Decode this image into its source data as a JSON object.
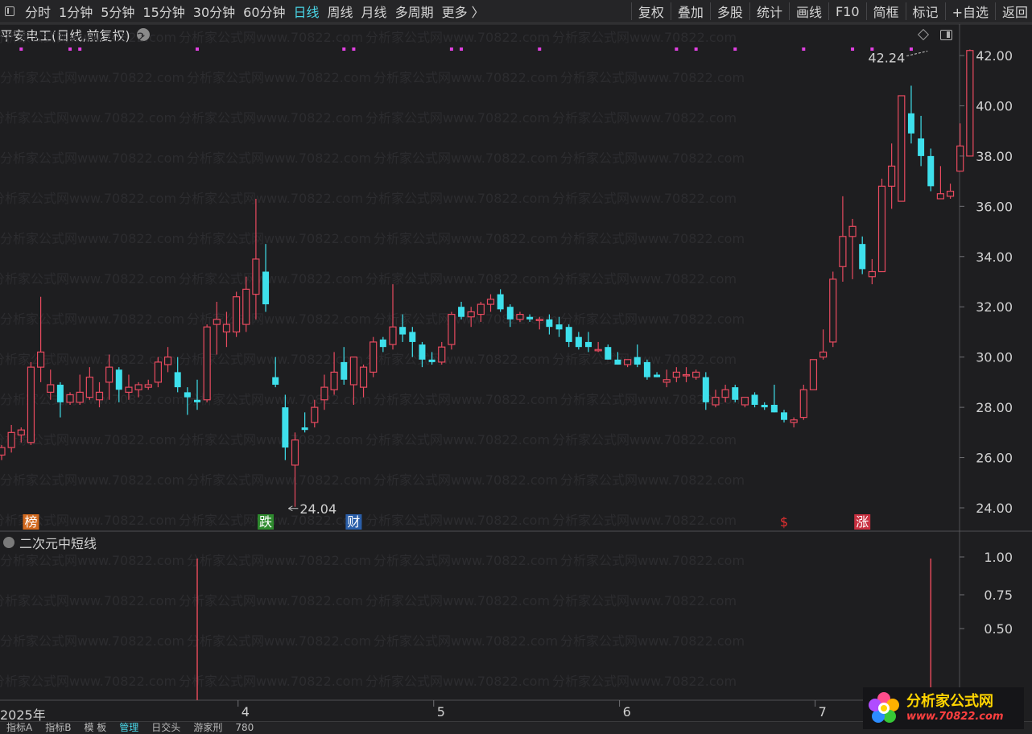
{
  "toolbar": {
    "left_items": [
      {
        "label": "分时",
        "active": false
      },
      {
        "label": "1分钟",
        "active": false
      },
      {
        "label": "5分钟",
        "active": false
      },
      {
        "label": "15分钟",
        "active": false
      },
      {
        "label": "30分钟",
        "active": false
      },
      {
        "label": "60分钟",
        "active": false
      },
      {
        "label": "日线",
        "active": true
      },
      {
        "label": "周线",
        "active": false
      },
      {
        "label": "月线",
        "active": false
      },
      {
        "label": "多周期",
        "active": false
      },
      {
        "label": "更多 〉",
        "active": false
      }
    ],
    "right_items": [
      "复权",
      "叠加",
      "多股",
      "统计",
      "画线",
      "F10",
      "简框",
      "标记",
      "+自选",
      "返回"
    ]
  },
  "chart_title": "平安电工(日线,前复权)",
  "indicator_title": "二次元中短线",
  "bottom_tabs": [
    {
      "label": "指标A",
      "active": false
    },
    {
      "label": "指标B",
      "active": false
    },
    {
      "label": "模 板",
      "active": false
    },
    {
      "label": "管理",
      "active": true
    },
    {
      "label": "日交头",
      "active": false
    },
    {
      "label": "游家刑",
      "active": false
    },
    {
      "label": "780",
      "active": false
    }
  ],
  "logo": {
    "name": "分析家公式网",
    "url": "www.70822.com"
  },
  "watermark_text": "分析家公式网www.70822.com",
  "colors": {
    "up": "#e84a5f",
    "down": "#3ee0ec",
    "background": "#1e1e20",
    "marker_dot": "#e040e0"
  },
  "chart_data": [
    {
      "type": "candlestick",
      "title": "平安电工(日线,前复权)",
      "ylim": [
        23.3,
        42.9
      ],
      "y_ticks": [
        "42.00",
        "40.00",
        "38.00",
        "36.00",
        "34.00",
        "32.00",
        "30.00",
        "28.00",
        "26.00",
        "24.00"
      ],
      "y_tick_values": [
        42,
        40,
        38,
        36,
        34,
        32,
        30,
        28,
        26,
        24
      ],
      "x_labels": [
        "2025年",
        "4",
        "5",
        "6",
        "7"
      ],
      "x_label_index": [
        0,
        25,
        45,
        64,
        84
      ],
      "annotations": [
        {
          "text": "42.24",
          "index": 95,
          "price": 42.24,
          "kind": "max"
        },
        {
          "text": "24.04",
          "index": 29,
          "price": 24.04,
          "kind": "min"
        }
      ],
      "event_markers": [
        {
          "text": "榜",
          "index": 3,
          "color": "#d2691e"
        },
        {
          "text": "跌",
          "index": 27,
          "color": "#2e8b2e"
        },
        {
          "text": "财",
          "index": 36,
          "color": "#2a5ea8"
        },
        {
          "text": "$",
          "index": 80,
          "color": "#e83030"
        },
        {
          "text": "涨",
          "index": 88,
          "color": "#c83040"
        }
      ],
      "top_dots_index": [
        2,
        7,
        8,
        20,
        35,
        36,
        46,
        47,
        55,
        69,
        71,
        75,
        82,
        87,
        89,
        93
      ],
      "candles": [
        {
          "o": 26.1,
          "h": 26.5,
          "l": 25.9,
          "c": 26.4
        },
        {
          "o": 26.4,
          "h": 27.3,
          "l": 26.2,
          "c": 27.0
        },
        {
          "o": 26.9,
          "h": 27.2,
          "l": 26.6,
          "c": 27.1
        },
        {
          "o": 26.6,
          "h": 29.8,
          "l": 26.5,
          "c": 29.6
        },
        {
          "o": 29.6,
          "h": 32.4,
          "l": 29.0,
          "c": 30.2
        },
        {
          "o": 28.6,
          "h": 29.5,
          "l": 28.3,
          "c": 28.9
        },
        {
          "o": 28.9,
          "h": 29.0,
          "l": 27.6,
          "c": 28.2
        },
        {
          "o": 28.2,
          "h": 28.6,
          "l": 28.1,
          "c": 28.5
        },
        {
          "o": 28.2,
          "h": 29.3,
          "l": 28.1,
          "c": 28.6
        },
        {
          "o": 28.4,
          "h": 29.6,
          "l": 28.3,
          "c": 29.2
        },
        {
          "o": 28.3,
          "h": 29.0,
          "l": 28.0,
          "c": 28.6
        },
        {
          "o": 29.0,
          "h": 30.1,
          "l": 28.3,
          "c": 29.6
        },
        {
          "o": 29.5,
          "h": 29.6,
          "l": 28.2,
          "c": 28.7
        },
        {
          "o": 28.6,
          "h": 29.3,
          "l": 28.3,
          "c": 28.8
        },
        {
          "o": 28.7,
          "h": 29.0,
          "l": 28.4,
          "c": 28.9
        },
        {
          "o": 28.8,
          "h": 29.1,
          "l": 28.7,
          "c": 28.9
        },
        {
          "o": 29.0,
          "h": 30.0,
          "l": 28.8,
          "c": 29.8
        },
        {
          "o": 29.7,
          "h": 30.4,
          "l": 29.4,
          "c": 30.0
        },
        {
          "o": 29.4,
          "h": 30.0,
          "l": 28.6,
          "c": 28.8
        },
        {
          "o": 28.6,
          "h": 28.8,
          "l": 27.7,
          "c": 28.4
        },
        {
          "o": 28.3,
          "h": 29.1,
          "l": 27.9,
          "c": 28.2
        },
        {
          "o": 28.3,
          "h": 31.3,
          "l": 28.2,
          "c": 31.2
        },
        {
          "o": 31.3,
          "h": 32.2,
          "l": 30.1,
          "c": 31.5
        },
        {
          "o": 31.0,
          "h": 31.8,
          "l": 30.4,
          "c": 31.3
        },
        {
          "o": 31.0,
          "h": 32.6,
          "l": 30.8,
          "c": 32.4
        },
        {
          "o": 31.3,
          "h": 33.2,
          "l": 31.0,
          "c": 32.7
        },
        {
          "o": 32.5,
          "h": 36.3,
          "l": 31.5,
          "c": 33.9
        },
        {
          "o": 33.4,
          "h": 34.5,
          "l": 31.8,
          "c": 32.1
        },
        {
          "o": 29.2,
          "h": 30.0,
          "l": 28.8,
          "c": 28.9
        },
        {
          "o": 28.0,
          "h": 28.5,
          "l": 25.9,
          "c": 26.4
        },
        {
          "o": 25.7,
          "h": 27.0,
          "l": 24.04,
          "c": 26.7
        },
        {
          "o": 27.2,
          "h": 27.8,
          "l": 27.0,
          "c": 27.1
        },
        {
          "o": 27.4,
          "h": 28.3,
          "l": 27.2,
          "c": 28.0
        },
        {
          "o": 28.3,
          "h": 29.3,
          "l": 27.9,
          "c": 28.8
        },
        {
          "o": 28.7,
          "h": 30.2,
          "l": 28.5,
          "c": 29.4
        },
        {
          "o": 29.8,
          "h": 30.4,
          "l": 28.9,
          "c": 29.1
        },
        {
          "o": 28.9,
          "h": 30.0,
          "l": 28.1,
          "c": 30.0
        },
        {
          "o": 28.8,
          "h": 29.7,
          "l": 28.4,
          "c": 29.6
        },
        {
          "o": 29.4,
          "h": 30.8,
          "l": 29.2,
          "c": 30.6
        },
        {
          "o": 30.7,
          "h": 30.8,
          "l": 30.2,
          "c": 30.4
        },
        {
          "o": 30.5,
          "h": 32.9,
          "l": 30.3,
          "c": 31.2
        },
        {
          "o": 31.2,
          "h": 31.7,
          "l": 30.6,
          "c": 30.9
        },
        {
          "o": 31.0,
          "h": 31.2,
          "l": 30.0,
          "c": 30.6
        },
        {
          "o": 30.5,
          "h": 30.6,
          "l": 29.6,
          "c": 29.9
        },
        {
          "o": 29.9,
          "h": 30.2,
          "l": 29.7,
          "c": 29.8
        },
        {
          "o": 29.8,
          "h": 30.6,
          "l": 29.7,
          "c": 30.4
        },
        {
          "o": 30.5,
          "h": 31.8,
          "l": 30.3,
          "c": 31.7
        },
        {
          "o": 32.0,
          "h": 32.2,
          "l": 31.5,
          "c": 31.6
        },
        {
          "o": 31.6,
          "h": 32.0,
          "l": 31.2,
          "c": 31.8
        },
        {
          "o": 31.7,
          "h": 32.2,
          "l": 31.4,
          "c": 32.1
        },
        {
          "o": 32.1,
          "h": 32.5,
          "l": 31.8,
          "c": 32.3
        },
        {
          "o": 32.5,
          "h": 32.7,
          "l": 31.8,
          "c": 31.9
        },
        {
          "o": 32.0,
          "h": 32.1,
          "l": 31.2,
          "c": 31.5
        },
        {
          "o": 31.5,
          "h": 31.8,
          "l": 31.4,
          "c": 31.7
        },
        {
          "o": 31.6,
          "h": 31.7,
          "l": 31.4,
          "c": 31.5
        },
        {
          "o": 31.5,
          "h": 31.6,
          "l": 31.1,
          "c": 31.5
        },
        {
          "o": 31.5,
          "h": 31.7,
          "l": 30.9,
          "c": 31.2
        },
        {
          "o": 31.3,
          "h": 31.6,
          "l": 30.8,
          "c": 31.1
        },
        {
          "o": 31.2,
          "h": 31.3,
          "l": 30.4,
          "c": 30.6
        },
        {
          "o": 30.8,
          "h": 31.0,
          "l": 30.3,
          "c": 30.4
        },
        {
          "o": 30.6,
          "h": 31.0,
          "l": 30.2,
          "c": 30.4
        },
        {
          "o": 30.3,
          "h": 30.6,
          "l": 30.2,
          "c": 30.3
        },
        {
          "o": 30.4,
          "h": 30.5,
          "l": 29.9,
          "c": 29.9
        },
        {
          "o": 29.9,
          "h": 30.2,
          "l": 29.7,
          "c": 29.7
        },
        {
          "o": 29.7,
          "h": 29.9,
          "l": 29.6,
          "c": 29.9
        },
        {
          "o": 30.0,
          "h": 30.5,
          "l": 29.6,
          "c": 29.7
        },
        {
          "o": 29.8,
          "h": 29.9,
          "l": 29.1,
          "c": 29.2
        },
        {
          "o": 29.3,
          "h": 29.4,
          "l": 29.2,
          "c": 29.2
        },
        {
          "o": 29.0,
          "h": 29.5,
          "l": 28.8,
          "c": 29.1
        },
        {
          "o": 29.2,
          "h": 29.6,
          "l": 29.0,
          "c": 29.4
        },
        {
          "o": 29.3,
          "h": 29.6,
          "l": 29.0,
          "c": 29.3
        },
        {
          "o": 29.2,
          "h": 29.5,
          "l": 29.1,
          "c": 29.4
        },
        {
          "o": 29.2,
          "h": 29.4,
          "l": 27.9,
          "c": 28.2
        },
        {
          "o": 28.1,
          "h": 28.7,
          "l": 28.0,
          "c": 28.4
        },
        {
          "o": 28.4,
          "h": 28.9,
          "l": 28.2,
          "c": 28.7
        },
        {
          "o": 28.8,
          "h": 28.9,
          "l": 28.2,
          "c": 28.3
        },
        {
          "o": 28.1,
          "h": 28.4,
          "l": 28.0,
          "c": 28.4
        },
        {
          "o": 28.5,
          "h": 28.6,
          "l": 28.0,
          "c": 28.1
        },
        {
          "o": 28.1,
          "h": 28.2,
          "l": 27.9,
          "c": 28.0
        },
        {
          "o": 28.1,
          "h": 28.9,
          "l": 27.8,
          "c": 27.8
        },
        {
          "o": 27.8,
          "h": 27.9,
          "l": 27.4,
          "c": 27.5
        },
        {
          "o": 27.4,
          "h": 27.6,
          "l": 27.2,
          "c": 27.5
        },
        {
          "o": 27.6,
          "h": 28.9,
          "l": 27.5,
          "c": 28.7
        },
        {
          "o": 28.7,
          "h": 29.9,
          "l": 28.7,
          "c": 29.9
        },
        {
          "o": 30.0,
          "h": 31.1,
          "l": 29.9,
          "c": 30.2
        },
        {
          "o": 30.6,
          "h": 33.4,
          "l": 30.4,
          "c": 33.1
        },
        {
          "o": 33.6,
          "h": 36.4,
          "l": 33.0,
          "c": 34.8
        },
        {
          "o": 34.8,
          "h": 35.5,
          "l": 33.1,
          "c": 35.2
        },
        {
          "o": 34.5,
          "h": 34.8,
          "l": 33.3,
          "c": 33.5
        },
        {
          "o": 33.2,
          "h": 33.9,
          "l": 32.9,
          "c": 33.4
        },
        {
          "o": 33.4,
          "h": 37.1,
          "l": 33.4,
          "c": 36.8
        },
        {
          "o": 36.8,
          "h": 38.5,
          "l": 35.9,
          "c": 37.6
        },
        {
          "o": 36.2,
          "h": 40.4,
          "l": 36.2,
          "c": 40.4
        },
        {
          "o": 39.7,
          "h": 40.8,
          "l": 38.5,
          "c": 38.9
        },
        {
          "o": 38.7,
          "h": 39.6,
          "l": 37.6,
          "c": 38.0
        },
        {
          "o": 38.0,
          "h": 38.3,
          "l": 36.6,
          "c": 36.8
        },
        {
          "o": 36.3,
          "h": 37.6,
          "l": 36.3,
          "c": 36.5
        },
        {
          "o": 36.4,
          "h": 36.9,
          "l": 36.3,
          "c": 36.6
        },
        {
          "o": 37.4,
          "h": 39.3,
          "l": 37.4,
          "c": 38.4
        },
        {
          "o": 38.0,
          "h": 42.24,
          "l": 38.0,
          "c": 42.2
        }
      ]
    },
    {
      "type": "bar",
      "title": "二次元中短线",
      "ylim": [
        0,
        1.0
      ],
      "y_ticks": [
        "1.00",
        "0.75",
        "0.50"
      ],
      "y_tick_values": [
        1.0,
        0.75,
        0.5
      ],
      "signal_index": [
        20,
        95
      ],
      "signal_values": [
        1,
        1
      ]
    }
  ]
}
